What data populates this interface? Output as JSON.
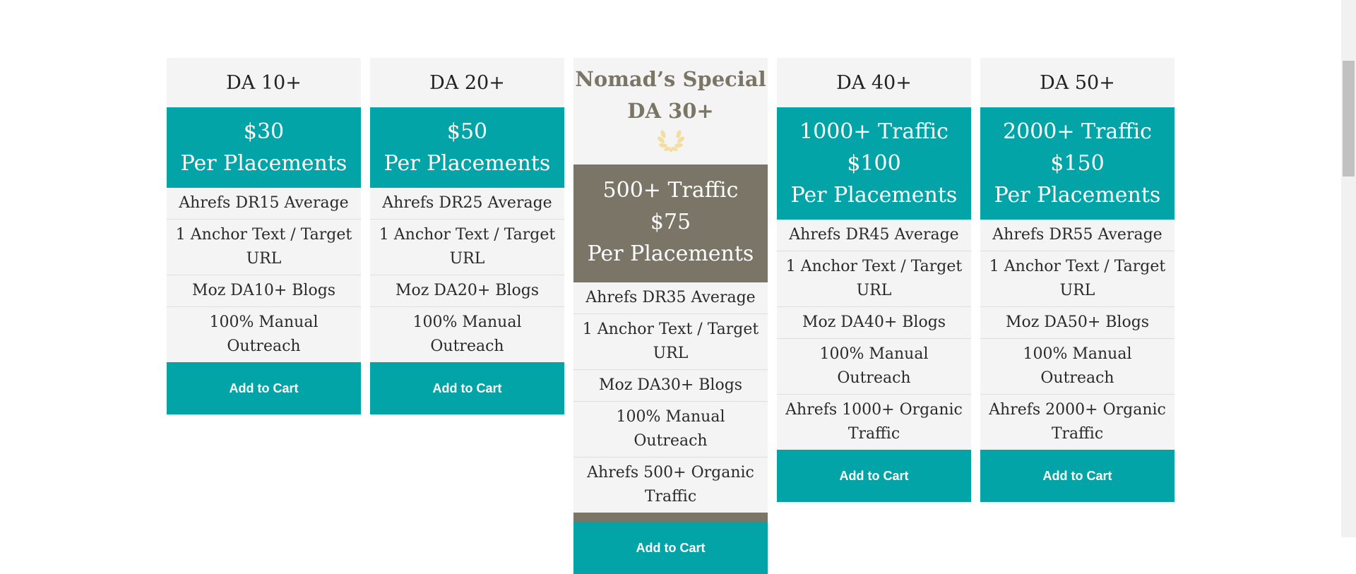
{
  "plans": [
    {
      "title": "DA 10+",
      "price_lines": [
        "$30",
        "Per Placements"
      ],
      "features": [
        "Ahrefs DR15 Average",
        "1 Anchor Text / Target URL",
        "Moz DA10+ Blogs",
        "100% Manual Outreach"
      ],
      "button": "Add to Cart"
    },
    {
      "title": "DA 20+",
      "price_lines": [
        "$50",
        "Per Placements"
      ],
      "features": [
        "Ahrefs DR25 Average",
        "1 Anchor Text / Target URL",
        "Moz DA20+ Blogs",
        "100% Manual Outreach"
      ],
      "button": "Add to Cart"
    },
    {
      "title_lines": [
        "Nomad’s Special",
        "DA 30+"
      ],
      "icon": "laurel-wreath-icon",
      "price_lines": [
        "500+ Traffic",
        "$75",
        "Per Placements"
      ],
      "features": [
        "Ahrefs DR35 Average",
        "1 Anchor Text / Target URL",
        "Moz DA30+ Blogs",
        "100% Manual Outreach",
        "Ahrefs 500+ Organic Traffic"
      ],
      "button": "Add to Cart"
    },
    {
      "title": "DA 40+",
      "price_lines": [
        "1000+ Traffic",
        "$100",
        "Per Placements"
      ],
      "features": [
        "Ahrefs DR45 Average",
        "1 Anchor Text / Target URL",
        "Moz DA40+ Blogs",
        "100% Manual Outreach",
        "Ahrefs 1000+ Organic Traffic"
      ],
      "button": "Add to Cart"
    },
    {
      "title": "DA 50+",
      "price_lines": [
        "2000+ Traffic",
        "$150",
        "Per Placements"
      ],
      "features": [
        "Ahrefs DR55 Average",
        "1 Anchor Text / Target URL",
        "Moz DA50+ Blogs",
        "100% Manual Outreach",
        "Ahrefs 2000+ Organic Traffic"
      ],
      "button": "Add to Cart"
    }
  ],
  "colors": {
    "teal": "#02a4a7",
    "special_gray": "#7a7566",
    "card_bg": "#f4f4f4",
    "laurel_gold": "#f3dea0"
  }
}
